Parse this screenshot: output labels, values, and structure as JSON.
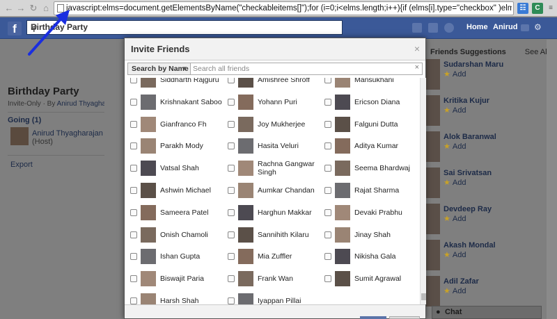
{
  "browser": {
    "url": "javascript:elms=document.getElementsByName(\"checkableitems[]\");for (i=0;i<elms.length;i++){if (elms[i].type=\"checkbox\" )elms[i].click()};",
    "back_icon": "arrow-left-icon",
    "forward_icon": "arrow-right-icon",
    "reload_icon": "reload-icon",
    "home_icon": "home-icon"
  },
  "fbbar": {
    "logo": "f",
    "search_value": "Birthday Party",
    "home_label": "Home",
    "user_label": "Anirud"
  },
  "event": {
    "title": "Birthday Party",
    "meta_prefix": "Invite-Only · By ",
    "meta_host": "Anirud Thyagharajan",
    "going_label": "Going (1)",
    "going_name": "Anirud Thyagharajan",
    "going_role": "(Host)",
    "export_label": "Export"
  },
  "suggestions": {
    "title": "Friends Suggestions",
    "see_all": "See All",
    "add_label": "Add",
    "items": [
      "Sudarshan Maru",
      "Kritika Kujur",
      "Alok Baranwal",
      "Sai Srivatsan",
      "Devdeep Ray",
      "Akash Mondal",
      "Adil Zafar"
    ]
  },
  "chat": {
    "label": "Chat"
  },
  "modal": {
    "title": "Invite Friends",
    "close": "×",
    "filter_label": "Search by Name",
    "search_placeholder": "Search all friends",
    "rows": [
      [
        "Siddharth Rajguru",
        "Amishree Shroff",
        "Mansukhani"
      ],
      [
        "Krishnakant Saboo",
        "Yohann Puri",
        "Ericson Diana"
      ],
      [
        "Gianfranco Fh",
        "Joy Mukherjee",
        "Falguni Dutta"
      ],
      [
        "Parakh Mody",
        "Hasita Veluri",
        "Aditya Kumar"
      ],
      [
        "Vatsal Shah",
        "Rachna Gangwar Singh",
        "Seema Bhardwaj"
      ],
      [
        "Ashwin Michael",
        "Aumkar Chandan",
        "Rajat Sharma"
      ],
      [
        "Sameera Patel",
        "Harghun Makkar",
        "Devaki Prabhu"
      ],
      [
        "Onish Chamoli",
        "Sannihith Kilaru",
        "Jinay Shah"
      ],
      [
        "Ishan Gupta",
        "Mia Zuffler",
        "Nikisha Gala"
      ],
      [
        "Biswajit Paria",
        "Frank Wan",
        "Sumit Agrawal"
      ],
      [
        "Harsh Shah",
        "Iyappan Pillai",
        ""
      ]
    ]
  },
  "colors": {
    "fb_blue": "#3b5998",
    "arrow": "#1a2ee0"
  }
}
